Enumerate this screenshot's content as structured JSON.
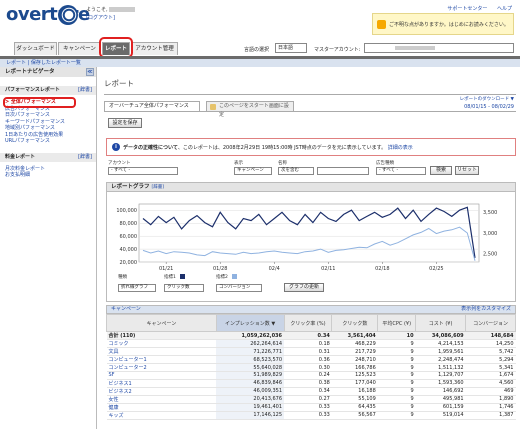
{
  "header": {
    "logo": "overture",
    "welcome": "ようこそ,",
    "logout": "[ログアウト]",
    "links": [
      "サポートセンター",
      "ヘルプ"
    ],
    "notice": "ご不明な点がありますか。はじめにお読みください。"
  },
  "tabs": [
    {
      "label": "ダッシュボード",
      "active": false
    },
    {
      "label": "キャンペーン",
      "active": false
    },
    {
      "label": "レポート",
      "active": true
    },
    {
      "label": "アカウント管理",
      "active": false
    }
  ],
  "date_selector": {
    "label": "言語の選択",
    "value": "日本語"
  },
  "master_account": {
    "label": "マスターアカウント:"
  },
  "breadcrumb": "レポート | 保存したレポート一覧",
  "sidebar": {
    "title": "レポートナビゲータ",
    "collapse": "≪",
    "sections": [
      {
        "label": "パフォーマンスレポート",
        "dict": "[辞書]",
        "items": [
          {
            "label": "> 全体パフォーマンス",
            "selected": true
          },
          {
            "label": "広告パフォーマンス",
            "selected": false
          },
          {
            "label": "日次パフォーマンス",
            "selected": false
          },
          {
            "label": "キーワードパフォーマンス",
            "selected": false
          },
          {
            "label": "地域別パフォーマンス",
            "selected": false
          },
          {
            "label": "1日あたりの広告使用効果",
            "selected": false
          },
          {
            "label": "URLパフォーマンス",
            "selected": false
          }
        ]
      },
      {
        "label": "料金レポート",
        "dict": "[辞書]",
        "items": [
          {
            "label": "月次料金レポート",
            "selected": false
          },
          {
            "label": "お支払明細",
            "selected": false
          }
        ]
      }
    ]
  },
  "main": {
    "title": "レポート",
    "download": "レポートのダウンロード ▼",
    "subtab1": "オーバーチュア全体パフォーマンス",
    "subtab2": "このページをスタート画面に設定",
    "date_range": "08/01/15 - 08/02/29",
    "save_button": "設定を保存",
    "info": {
      "bold": "データの正確性について",
      "text": "、このレポートは、2008年2月29日 19時15:00時 JST時点のデータを元に表示しています。",
      "link": "詳細の表示"
    },
    "filters": {
      "campaign": {
        "label": "アカウント",
        "value": "- すべて -"
      },
      "metric": {
        "label": "表示",
        "value": "キャンペーン"
      },
      "name": {
        "label": "名称",
        "value": "次を含む"
      },
      "group": {
        "label": "広告種類",
        "value": "- すべて -"
      },
      "search_button": "検索",
      "reset_button": "リセット"
    },
    "graph": {
      "title": "レポートグラフ",
      "dict": "[辞書]",
      "controls": [
        {
          "label": "種類",
          "value": "折れ線グラフ"
        },
        {
          "label": "指標1",
          "value": "クリック数"
        },
        {
          "label": "指標2",
          "value": "コンバージョン"
        }
      ],
      "update_button": "グラフの更新"
    },
    "table": {
      "bar_label": "キャンペーン",
      "bar_right": "表示列をカスタマイズ",
      "columns": [
        "キャンペーン",
        "インプレッション数 ▼",
        "クリック率 (%)",
        "クリック数",
        "平均CPC (¥)",
        "コスト (¥)",
        "コンバージョン"
      ],
      "total": [
        "合計 (110)",
        "1,059,262,036",
        "0.34",
        "3,561,404",
        "10",
        "34,086,609",
        "148,684"
      ],
      "rows": [
        [
          "コミック",
          "262,264,614",
          "0.18",
          "468,229",
          "9",
          "4,214,153",
          "14,250"
        ],
        [
          "文具",
          "71,226,771",
          "0.31",
          "217,729",
          "9",
          "1,959,561",
          "5,742"
        ],
        [
          "コンピューター1",
          "68,523,570",
          "0.36",
          "248,710",
          "9",
          "2,248,474",
          "5,294"
        ],
        [
          "コンピューター2",
          "55,640,028",
          "0.30",
          "166,786",
          "9",
          "1,511,132",
          "5,341"
        ],
        [
          "SF",
          "51,989,829",
          "0.24",
          "125,523",
          "9",
          "1,129,707",
          "1,674"
        ],
        [
          "ビジネス1",
          "46,839,846",
          "0.38",
          "177,040",
          "9",
          "1,593,360",
          "4,560"
        ],
        [
          "ビジネス2",
          "46,009,351",
          "0.34",
          "16,188",
          "9",
          "146,692",
          "469"
        ],
        [
          "女性",
          "20,413,676",
          "0.27",
          "55,109",
          "9",
          "495,981",
          "1,890"
        ],
        [
          "健康",
          "19,461,401",
          "0.33",
          "64,435",
          "9",
          "601,159",
          "1,746"
        ],
        [
          "キッズ",
          "17,146,125",
          "0.33",
          "56,567",
          "9",
          "519,014",
          "1,387"
        ]
      ]
    }
  },
  "chart_data": {
    "type": "line",
    "x_ticks": [
      "01/21",
      "01/28",
      "02/4",
      "02/11",
      "02/18",
      "02/25"
    ],
    "y_left_ticks": [
      "100,000",
      "80,000",
      "60,000",
      "40,000",
      "20,000"
    ],
    "y_right_ticks": [
      "3,500",
      "3,000",
      "2,500"
    ],
    "ylim_left": [
      20000,
      110000
    ],
    "ylim_right": [
      2300,
      3700
    ],
    "series": [
      {
        "color": "#1c2f6b",
        "axis": "right",
        "values": [
          3350,
          3200,
          3400,
          3250,
          3380,
          3100,
          3300,
          3420,
          3250,
          3150,
          3500,
          3250,
          3100,
          3350,
          3300,
          3450,
          3200,
          3350,
          3500,
          3300,
          3200,
          3450,
          3250,
          3500,
          3350,
          3280,
          3450,
          3550,
          3300,
          3400,
          3500,
          3380,
          3450,
          3600,
          3350,
          3550,
          3280,
          3450,
          3600,
          3520,
          3400,
          3550,
          3620,
          2400
        ]
      },
      {
        "color": "#8fb2e0",
        "axis": "left",
        "values": [
          38000,
          34000,
          37000,
          33000,
          36000,
          35000,
          34000,
          31000,
          30000,
          36000,
          34000,
          33000,
          32000,
          35000,
          33000,
          34000,
          36000,
          37000,
          35000,
          34000,
          33000,
          36000,
          37000,
          40000,
          35000,
          38000,
          39000,
          41000,
          43000,
          42000,
          48000,
          52000,
          46000,
          50000,
          56000,
          62000,
          66000,
          72000,
          64000,
          68000,
          70000,
          74000,
          65000,
          22000
        ]
      }
    ]
  }
}
